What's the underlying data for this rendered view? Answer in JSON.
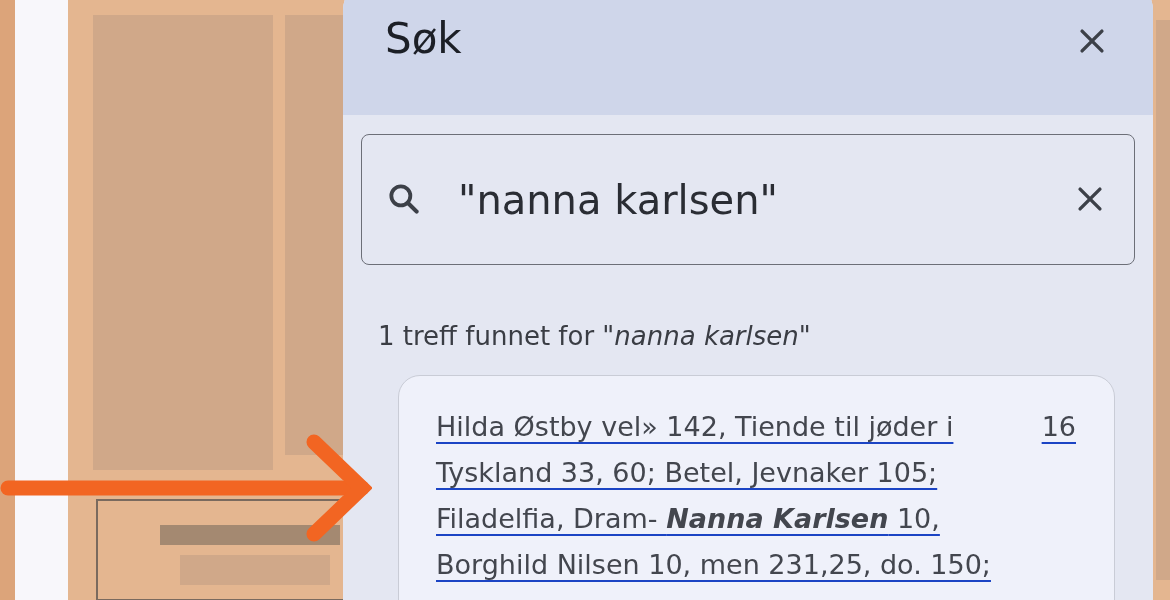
{
  "dialog": {
    "title": "Søk",
    "search": {
      "value": "\"nanna karlsen\""
    },
    "summary": "1 treff funnet for *\"nanna karlsen\"*",
    "results": [
      {
        "lines": [
          "Hilda Østby vel» 142, Tiende til jøder i",
          "Tyskland 33, 60; Betel, Jevnaker 105;",
          "Filadelfia, Dram- **Nanna Karlsen** 10,",
          "Borghild Nilsen 10, men 231,25, do. 150;"
        ],
        "page": "16"
      }
    ]
  }
}
